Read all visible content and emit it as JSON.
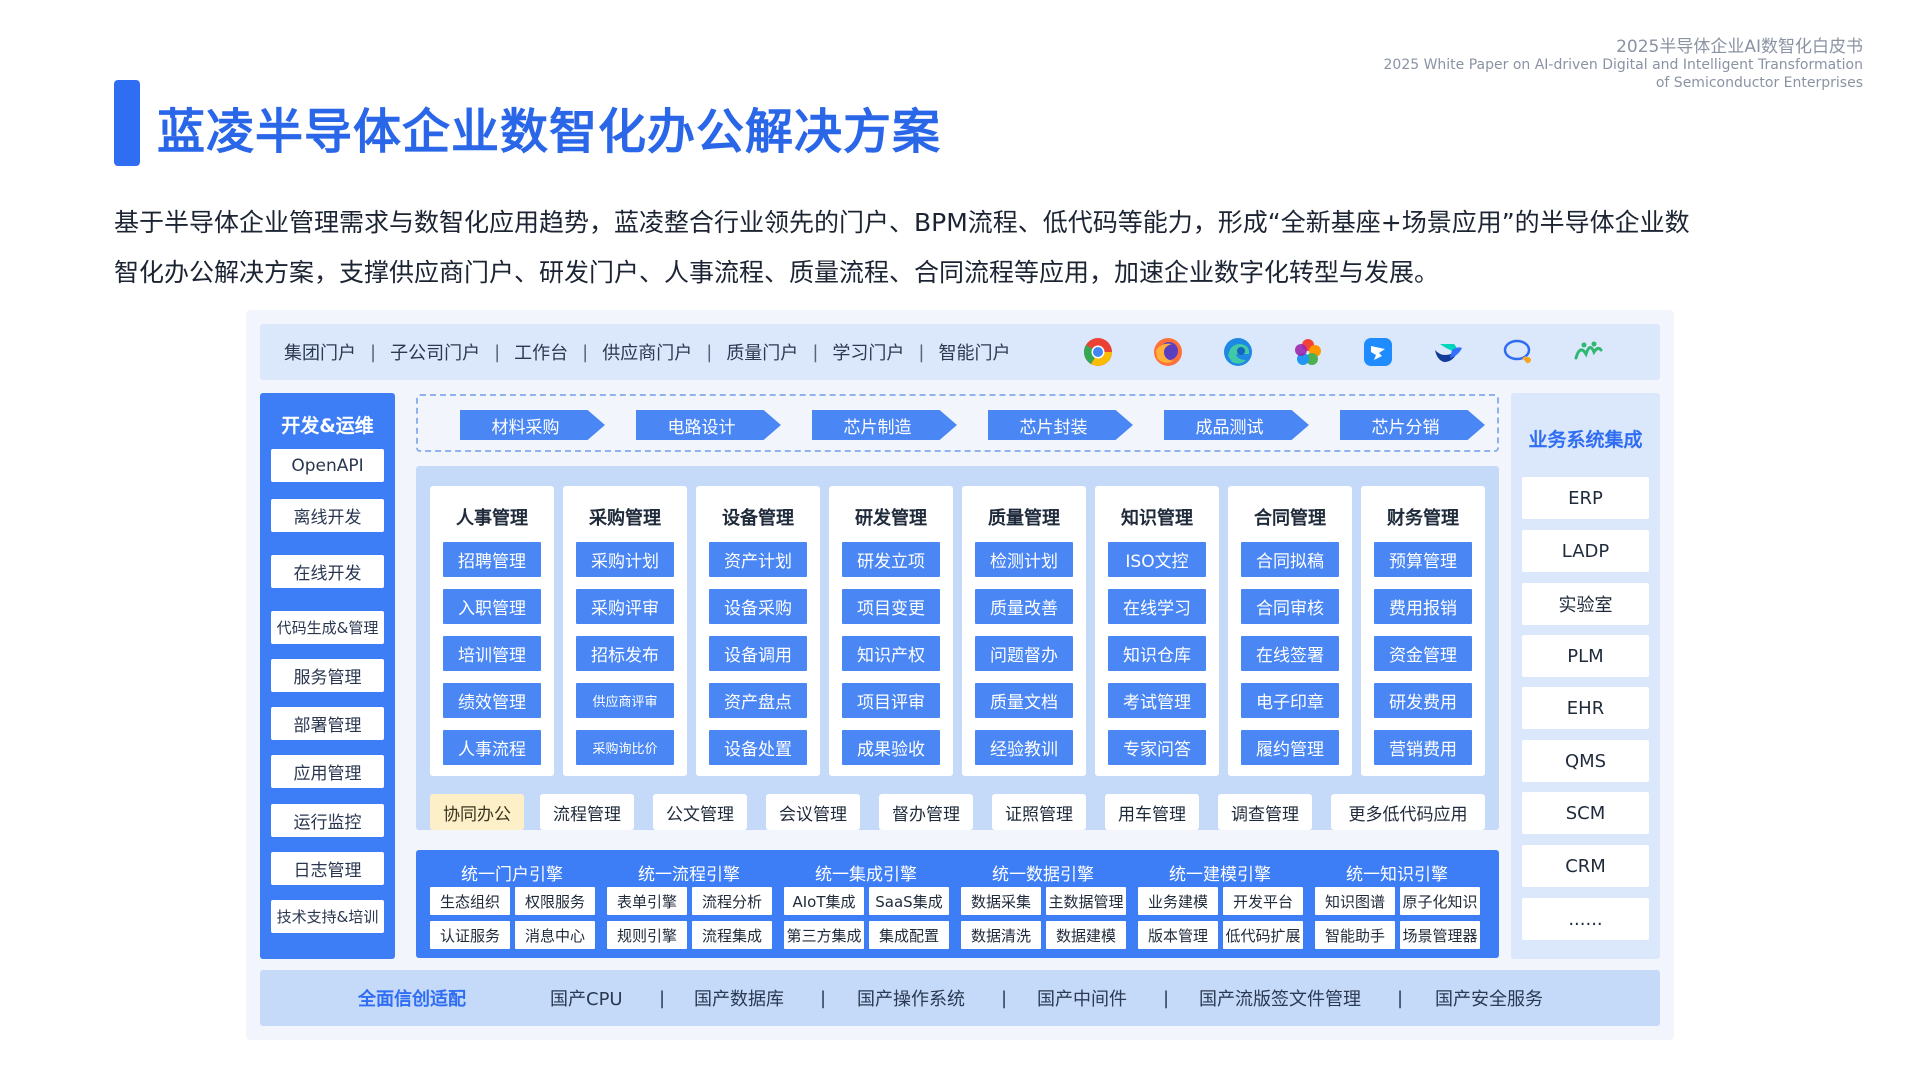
{
  "header_note": {
    "line1": "2025半导体企业AI数智化白皮书",
    "line2": "2025 White Paper on AI-driven Digital and Intelligent Transformation",
    "line3": "of Semiconductor Enterprises"
  },
  "title": "蓝凌半导体企业数智化办公解决方案",
  "intro": {
    "line1": "基于半导体企业管理需求与数智化应用趋势，蓝凌整合行业领先的门户、BPM流程、低代码等能力，形成“全新基座+场景应用”的半导体企业数",
    "line2": "智化办公解决方案，支撑供应商门户、研发门户、人事流程、质量流程、合同流程等应用，加速企业数字化转型与发展。"
  },
  "portal_bar": {
    "items": [
      "集团门户",
      "子公司门户",
      "工作台",
      "供应商门户",
      "质量门户",
      "学习门户",
      "智能门户"
    ],
    "separator": "|",
    "icons": [
      "chrome-icon",
      "firefox-icon",
      "edge-icon",
      "petal-icon",
      "dingtalk-icon",
      "feishu-icon",
      "chat-bubble-icon",
      "brand-logo-icon"
    ]
  },
  "left_column": {
    "title": "开发&运维",
    "items": [
      "OpenAPI",
      "离线开发",
      "在线开发",
      "代码生成&管理",
      "服务管理",
      "部署管理",
      "应用管理",
      "运行监控",
      "日志管理",
      "技术支持&培训"
    ]
  },
  "process_flow": [
    "材料采购",
    "电路设计",
    "芯片制造",
    "芯片封装",
    "成品测试",
    "芯片分销"
  ],
  "modules": [
    {
      "title": "人事管理",
      "items": [
        "招聘管理",
        "入职管理",
        "培训管理",
        "绩效管理",
        "人事流程"
      ]
    },
    {
      "title": "采购管理",
      "items": [
        "采购计划",
        "采购评审",
        "招标发布",
        "供应商评审",
        "采购询比价"
      ]
    },
    {
      "title": "设备管理",
      "items": [
        "资产计划",
        "设备采购",
        "设备调用",
        "资产盘点",
        "设备处置"
      ]
    },
    {
      "title": "研发管理",
      "items": [
        "研发立项",
        "项目变更",
        "知识产权",
        "项目评审",
        "成果验收"
      ]
    },
    {
      "title": "质量管理",
      "items": [
        "检测计划",
        "质量改善",
        "问题督办",
        "质量文档",
        "经验教训"
      ]
    },
    {
      "title": "知识管理",
      "items": [
        "ISO文控",
        "在线学习",
        "知识仓库",
        "考试管理",
        "专家问答"
      ]
    },
    {
      "title": "合同管理",
      "items": [
        "合同拟稿",
        "合同审核",
        "在线签署",
        "电子印章",
        "履约管理"
      ]
    },
    {
      "title": "财务管理",
      "items": [
        "预算管理",
        "费用报销",
        "资金管理",
        "研发费用",
        "营销费用"
      ]
    }
  ],
  "collab_row": [
    "协同办公",
    "流程管理",
    "公文管理",
    "会议管理",
    "督办管理",
    "证照管理",
    "用车管理",
    "调查管理",
    "更多低代码应用"
  ],
  "engines": [
    {
      "title": "统一门户引擎",
      "items": [
        "生态组织",
        "权限服务",
        "认证服务",
        "消息中心"
      ]
    },
    {
      "title": "统一流程引擎",
      "items": [
        "表单引擎",
        "流程分析",
        "规则引擎",
        "流程集成"
      ]
    },
    {
      "title": "统一集成引擎",
      "items": [
        "AIoT集成",
        "SaaS集成",
        "第三方集成",
        "集成配置"
      ]
    },
    {
      "title": "统一数据引擎",
      "items": [
        "数据采集",
        "主数据管理",
        "数据清洗",
        "数据建模"
      ]
    },
    {
      "title": "统一建模引擎",
      "items": [
        "业务建模",
        "开发平台",
        "版本管理",
        "低代码扩展"
      ]
    },
    {
      "title": "统一知识引擎",
      "items": [
        "知识图谱",
        "原子化知识",
        "智能助手",
        "场景管理器"
      ]
    }
  ],
  "right_column": {
    "title": "业务系统集成",
    "items": [
      "ERP",
      "LADP",
      "实验室",
      "PLM",
      "EHR",
      "QMS",
      "SCM",
      "CRM",
      "......"
    ]
  },
  "footer_bar": {
    "label": "全面信创适配",
    "items": [
      "国产CPU",
      "国产数据库",
      "国产操作系统",
      "国产中间件",
      "国产流版签文件管理",
      "国产安全服务"
    ],
    "separator": "|"
  },
  "colors": {
    "primary": "#2f6df3",
    "panel_blue": "#3d7ef7",
    "button_blue": "#4a87f4",
    "light_panel": "#dbe7fb",
    "mid_panel": "#c5d9f9",
    "highlight": "#fdf0c8"
  }
}
